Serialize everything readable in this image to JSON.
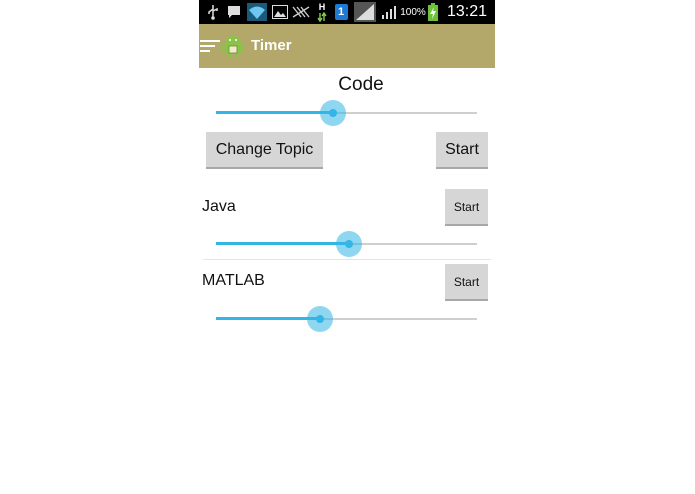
{
  "status_bar": {
    "h_indicator": "H",
    "notification_count": "1",
    "battery_percent": "100%",
    "time": "13:21",
    "icons": [
      "usb-icon",
      "chat-icon",
      "wifi-icon",
      "image-icon",
      "no-sim-icon",
      "data-activity-icon",
      "notification-badge-icon",
      "signal-icon",
      "signal-icon-2",
      "battery-charging-icon"
    ]
  },
  "action_bar": {
    "title": "Timer",
    "color": "#b3a76a"
  },
  "main_timer": {
    "label": "Code",
    "slider_level": 0.45,
    "change_topic_label": "Change Topic",
    "start_label": "Start"
  },
  "topics": [
    {
      "name": "Java",
      "start_label": "Start",
      "slider_level": 0.51
    },
    {
      "name": "MATLAB",
      "start_label": "Start",
      "slider_level": 0.4
    }
  ],
  "colors": {
    "accent": "#33b5e5",
    "button": "#d6d6d6"
  }
}
